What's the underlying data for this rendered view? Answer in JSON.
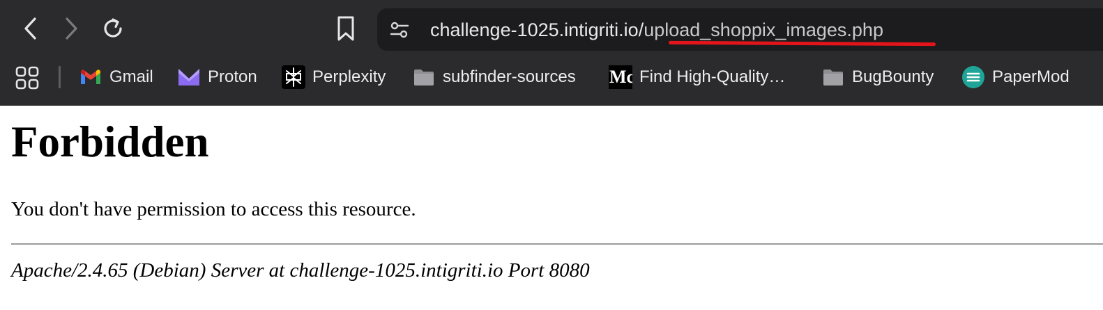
{
  "browser": {
    "url_host": "challenge-1025.intigriti.io/",
    "url_path": "upload_shoppix_images.php",
    "icons": {
      "back": "chevron-left-icon",
      "forward": "chevron-right-icon",
      "reload": "reload-icon",
      "bookmark": "bookmark-icon",
      "site_settings": "tune-icon",
      "apps": "apps-grid-icon"
    },
    "colors": {
      "chrome_bg": "#2b2b2d",
      "address_bg": "#1c1c1e",
      "highlight_underline": "#e3151b"
    }
  },
  "bookmarks": [
    {
      "label": "Gmail",
      "icon": "gmail-icon"
    },
    {
      "label": "Proton",
      "icon": "proton-icon"
    },
    {
      "label": "Perplexity",
      "icon": "perplexity-icon"
    },
    {
      "label": "subfinder-sources",
      "icon": "folder-icon"
    },
    {
      "label": "Find High-Quality…",
      "icon": "medium-icon",
      "icon_text": "Mc"
    },
    {
      "label": "BugBounty",
      "icon": "folder-icon"
    },
    {
      "label": "PaperMod",
      "icon": "papermod-icon"
    }
  ],
  "page": {
    "title": "Forbidden",
    "message": "You don't have permission to access this resource.",
    "server_signature": "Apache/2.4.65 (Debian) Server at challenge-1025.intigriti.io Port 8080"
  }
}
